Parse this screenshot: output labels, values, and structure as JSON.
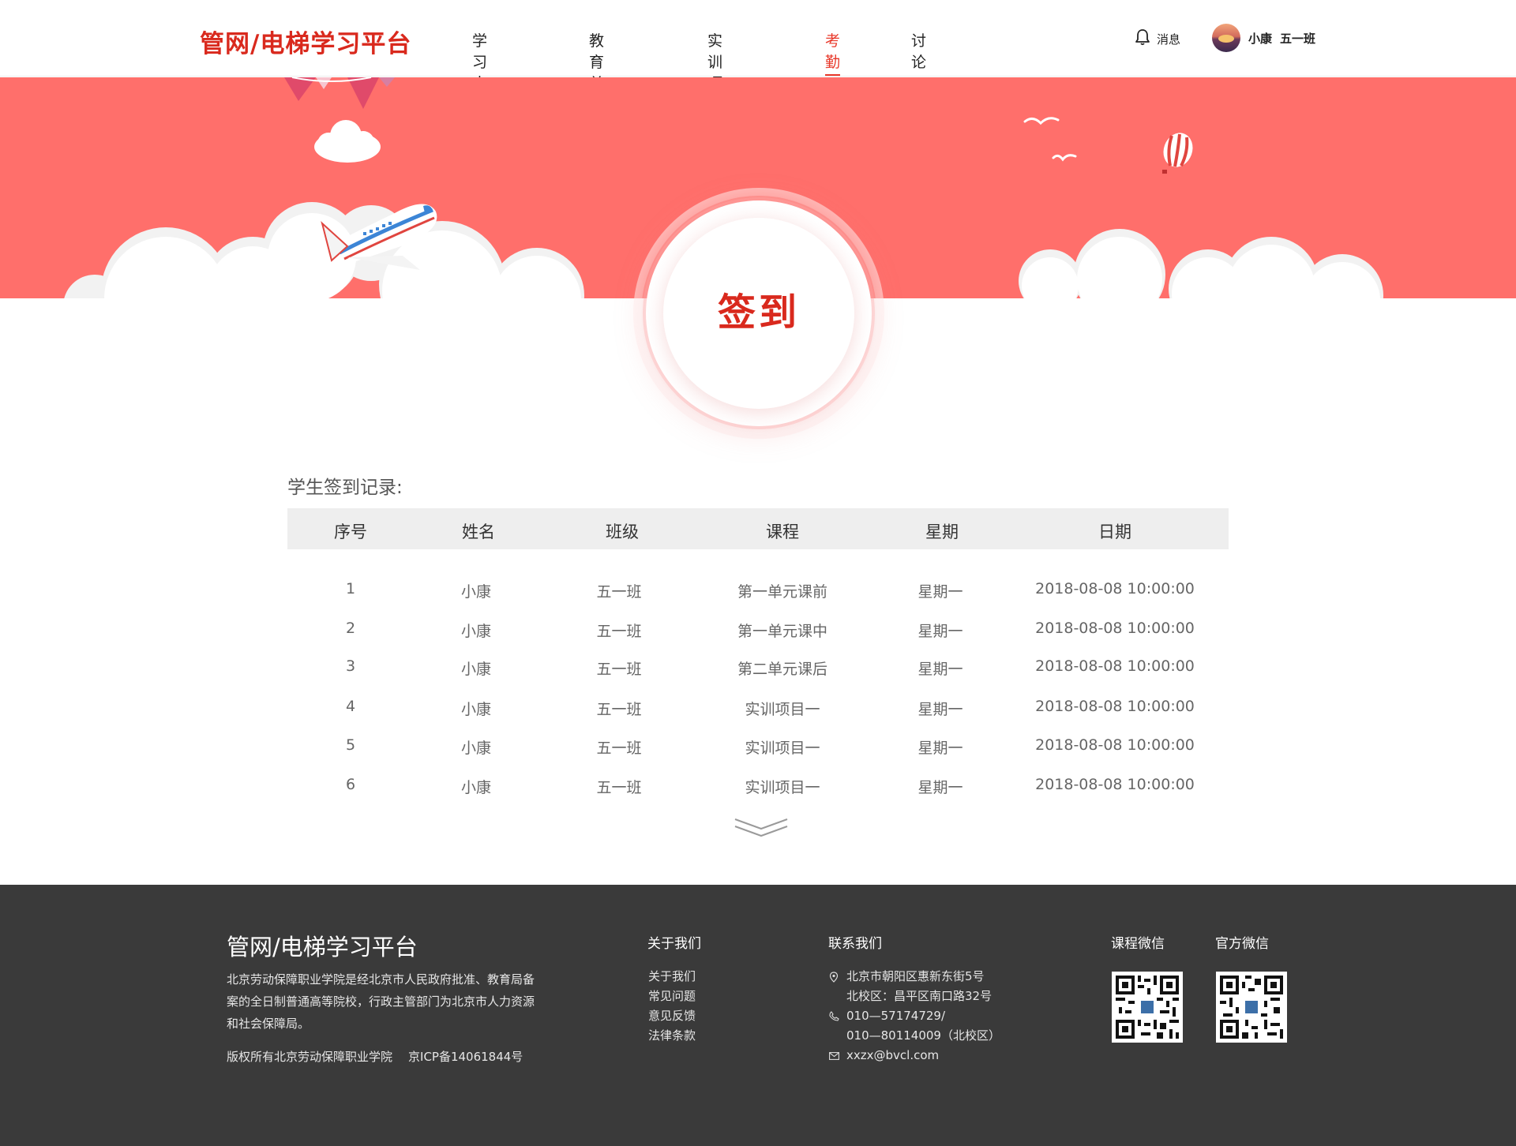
{
  "header": {
    "logo": "管网/电梯学习平台",
    "nav": [
      {
        "label": "学习中心",
        "active": false
      },
      {
        "label": "教育单元",
        "active": false
      },
      {
        "label": "实训项目",
        "active": false
      },
      {
        "label": "考勤",
        "active": true
      },
      {
        "label": "讨论",
        "active": false
      }
    ],
    "message_label": "消息",
    "user_name": "小康",
    "user_class": "五一班"
  },
  "banner": {
    "title": "签到",
    "background_color": "#ff6f6b"
  },
  "records": {
    "title": "学生签到记录:",
    "columns": [
      "序号",
      "姓名",
      "班级",
      "课程",
      "星期",
      "日期"
    ],
    "rows": [
      [
        "1",
        "小康",
        "五一班",
        "第一单元课前",
        "星期一",
        "2018-08-08 10:00:00"
      ],
      [
        "2",
        "小康",
        "五一班",
        "第一单元课中",
        "星期一",
        "2018-08-08 10:00:00"
      ],
      [
        "3",
        "小康",
        "五一班",
        "第二单元课后",
        "星期一",
        "2018-08-08 10:00:00"
      ],
      [
        "4",
        "小康",
        "五一班",
        "实训项目一",
        "星期一",
        "2018-08-08 10:00:00"
      ],
      [
        "5",
        "小康",
        "五一班",
        "实训项目一",
        "星期一",
        "2018-08-08 10:00:00"
      ],
      [
        "6",
        "小康",
        "五一班",
        "实训项目一",
        "星期一",
        "2018-08-08 10:00:00"
      ]
    ],
    "more_icon": "double-chevron-down-icon"
  },
  "footer": {
    "logo": "管网/电梯学习平台",
    "description": "北京劳动保障职业学院是经北京市人民政府批准、教育局备案的全日制普通高等院校，行政主管部门为北京市人力资源和社会保障局。",
    "copyright": "版权所有北京劳动保障职业学院",
    "icp": "京ICP备14061844号",
    "about_title": "关于我们",
    "about_links": [
      "关于我们",
      "常见问题",
      "意见反馈",
      "法律条款"
    ],
    "contact_title": "联系我们",
    "address_line1": "北京市朝阳区惠新东街5号",
    "address_line2": "北校区：昌平区南口路32号",
    "phone_line1": "010—57174729/",
    "phone_line2": "010—80114009（北校区）",
    "email": "xxzx@bvcl.com",
    "qr_course_title": "课程微信",
    "qr_official_title": "官方微信",
    "background_color": "#3a3a3a"
  },
  "colors": {
    "brand": "#d9291d",
    "nav_active": "#e8382a"
  }
}
